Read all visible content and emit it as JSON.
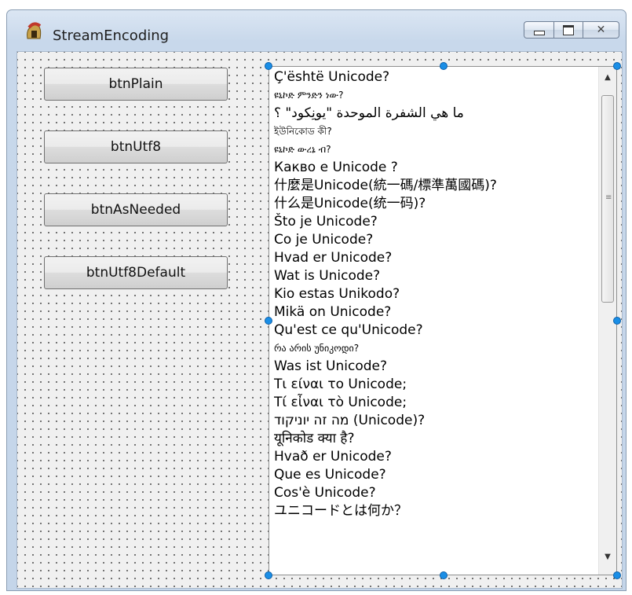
{
  "window": {
    "title": "StreamEncoding"
  },
  "buttons": [
    {
      "label": "btnPlain"
    },
    {
      "label": "btnUtf8"
    },
    {
      "label": "btnAsNeeded"
    },
    {
      "label": "btnUtf8Default"
    }
  ],
  "memo": {
    "lines": [
      "Ç'është Unicode?",
      "ዩኒኮድ ምንድን ነው?",
      "ما هي الشفرة الموحدة \"يونِكود\" ؟",
      "ইউনিকোড কী?",
      "ዩኒኮድ ውረኔ ብ?",
      "Какво е Unicode ?",
      "什麼是Unicode(統一碼/標準萬國碼)?",
      "什么是Unicode(统一码)?",
      "Što je Unicode?",
      "Co je Unicode?",
      "Hvad er Unicode?",
      "Wat is Unicode?",
      "Kio estas Unikodo?",
      "Mikä on Unicode?",
      "Qu'est ce qu'Unicode?",
      "რა არის უნიკოდი?",
      "Was ist Unicode?",
      "Τι είναι το Unicode;",
      "Τί εἶναι τὸ Unicode;",
      "מה זה יוניקוד (Unicode)?",
      "यूनिकोड क्या है?",
      "Hvað er Unicode?",
      "Que es Unicode?",
      "Cos'è Unicode?",
      "ユニコードとは何か？"
    ]
  },
  "colors": {
    "handle": "#1a8ee6",
    "client_bg": "#f0f0f0"
  }
}
